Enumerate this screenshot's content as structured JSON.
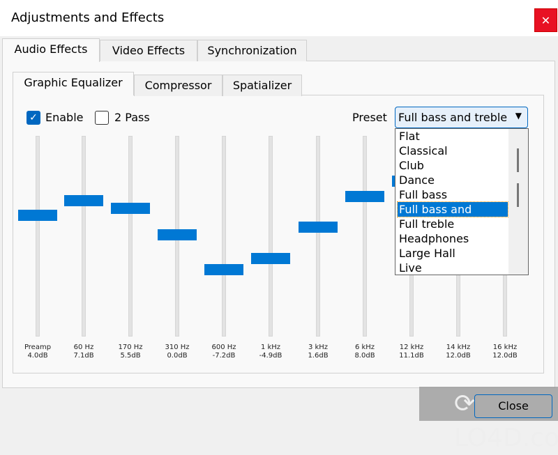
{
  "window": {
    "title": "Adjustments and Effects",
    "close_icon": "close-icon"
  },
  "tabs": [
    "Audio Effects",
    "Video Effects",
    "Synchronization"
  ],
  "subtabs": [
    "Graphic Equalizer",
    "Compressor",
    "Spatializer"
  ],
  "enable": {
    "label": "Enable",
    "checked": true
  },
  "two_pass": {
    "label": "2 Pass",
    "checked": false
  },
  "preset": {
    "label": "Preset",
    "value": "Full bass and treble",
    "options": [
      "Flat",
      "Classical",
      "Club",
      "Dance",
      "Full bass",
      "Full bass and treble",
      "Full treble",
      "Headphones",
      "Large Hall",
      "Live"
    ]
  },
  "bands": [
    {
      "name": "Preamp",
      "value": "4.0dB",
      "db": 4.0
    },
    {
      "name": "60 Hz",
      "value": "7.1dB",
      "db": 7.1
    },
    {
      "name": "170 Hz",
      "value": "5.5dB",
      "db": 5.5
    },
    {
      "name": "310 Hz",
      "value": "0.0dB",
      "db": 0.0
    },
    {
      "name": "600 Hz",
      "value": "-7.2dB",
      "db": -7.2
    },
    {
      "name": "1 kHz",
      "value": "-4.9dB",
      "db": -4.9
    },
    {
      "name": "3 kHz",
      "value": "1.6dB",
      "db": 1.6
    },
    {
      "name": "6 kHz",
      "value": "8.0dB",
      "db": 8.0
    },
    {
      "name": "12 kHz",
      "value": "11.1dB",
      "db": 11.1
    },
    {
      "name": "14 kHz",
      "value": "12.0dB",
      "db": 12.0
    },
    {
      "name": "16 kHz",
      "value": "12.0dB",
      "db": 12.0
    }
  ],
  "close_label": "Close",
  "watermark": "LO4D.com",
  "accent": "#0078d4"
}
